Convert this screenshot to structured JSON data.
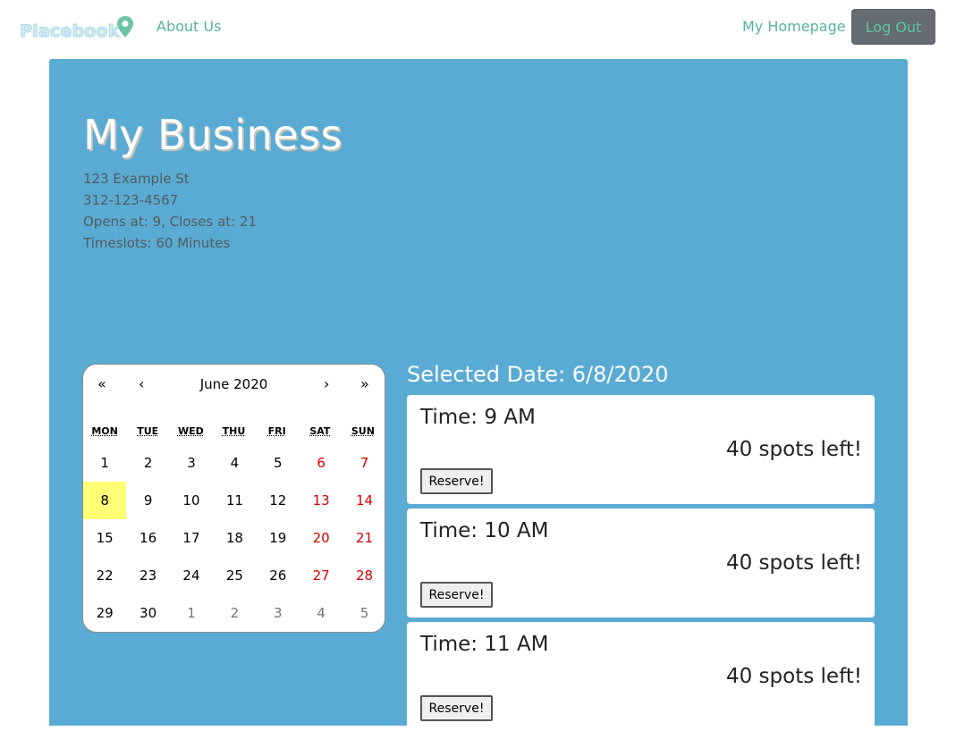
{
  "navbar": {
    "logo_text": "Placebook",
    "about_label": "About Us",
    "homepage_label": "My Homepage",
    "logout_label": "Log Out"
  },
  "business": {
    "name": "My Business",
    "address": "123 Example St",
    "phone": "312-123-4567",
    "hours": "Opens at: 9, Closes at: 21",
    "timeslots": "Timeslots: 60 Minutes"
  },
  "calendar": {
    "prev_year": "«",
    "prev_month": "‹",
    "month_label": "June 2020",
    "next_month": "›",
    "next_year": "»",
    "weekdays": [
      "MON",
      "TUE",
      "WED",
      "THU",
      "FRI",
      "SAT",
      "SUN"
    ],
    "days": [
      {
        "label": "1"
      },
      {
        "label": "2"
      },
      {
        "label": "3"
      },
      {
        "label": "4"
      },
      {
        "label": "5"
      },
      {
        "label": "6",
        "weekend": true
      },
      {
        "label": "7",
        "weekend": true
      },
      {
        "label": "8",
        "selected": true
      },
      {
        "label": "9"
      },
      {
        "label": "10"
      },
      {
        "label": "11"
      },
      {
        "label": "12"
      },
      {
        "label": "13",
        "weekend": true
      },
      {
        "label": "14",
        "weekend": true
      },
      {
        "label": "15"
      },
      {
        "label": "16"
      },
      {
        "label": "17"
      },
      {
        "label": "18"
      },
      {
        "label": "19"
      },
      {
        "label": "20",
        "weekend": true
      },
      {
        "label": "21",
        "weekend": true
      },
      {
        "label": "22"
      },
      {
        "label": "23"
      },
      {
        "label": "24"
      },
      {
        "label": "25"
      },
      {
        "label": "26"
      },
      {
        "label": "27",
        "weekend": true
      },
      {
        "label": "28",
        "weekend": true
      },
      {
        "label": "29"
      },
      {
        "label": "30"
      },
      {
        "label": "1",
        "other": true
      },
      {
        "label": "2",
        "other": true
      },
      {
        "label": "3",
        "other": true
      },
      {
        "label": "4",
        "other": true
      },
      {
        "label": "5",
        "other": true
      }
    ]
  },
  "schedule": {
    "selected_date": "Selected Date: 6/8/2020",
    "slots": [
      {
        "time": "Time: 9 AM",
        "spots": "40 spots left!",
        "button": "Reserve!"
      },
      {
        "time": "Time: 10 AM",
        "spots": "40 spots left!",
        "button": "Reserve!"
      },
      {
        "time": "Time: 11 AM",
        "spots": "40 spots left!",
        "button": "Reserve!"
      }
    ]
  },
  "colors": {
    "panel": "#5aabd3",
    "nav_link": "#56b39a",
    "logout_bg": "#646b71",
    "selected_day": "#ffff76",
    "weekend": "#d10000"
  }
}
